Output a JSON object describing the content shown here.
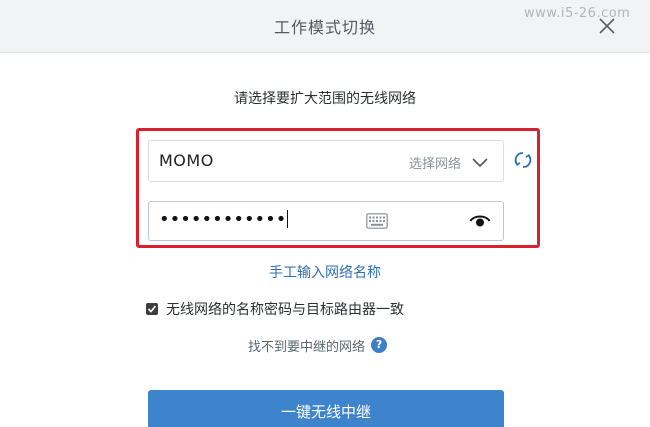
{
  "header": {
    "title": "工作模式切换",
    "watermark": "www.i5-26.com"
  },
  "form": {
    "prompt": "请选择要扩大范围的无线网络",
    "ssid": {
      "value": "MOMO",
      "select_label": "选择网络"
    },
    "password": {
      "masked_value": "••••••••••••"
    },
    "manual_link": "手工输入网络名称",
    "consistent_checkbox": {
      "checked": true,
      "label": "无线网络的名称密码与目标路由器一致"
    },
    "not_found_link": "找不到要中继的网络",
    "help_icon": "?",
    "submit_label": "一键无线中继"
  },
  "colors": {
    "accent": "#3d84cc",
    "highlight_frame": "#d8212f",
    "link": "#2f6fb5"
  },
  "icons": {
    "close": "close-icon",
    "chevron": "chevron-down-icon",
    "refresh": "refresh-icon",
    "keyboard": "keyboard-icon",
    "eye": "eye-icon",
    "help": "help-icon",
    "check": "check-icon"
  }
}
